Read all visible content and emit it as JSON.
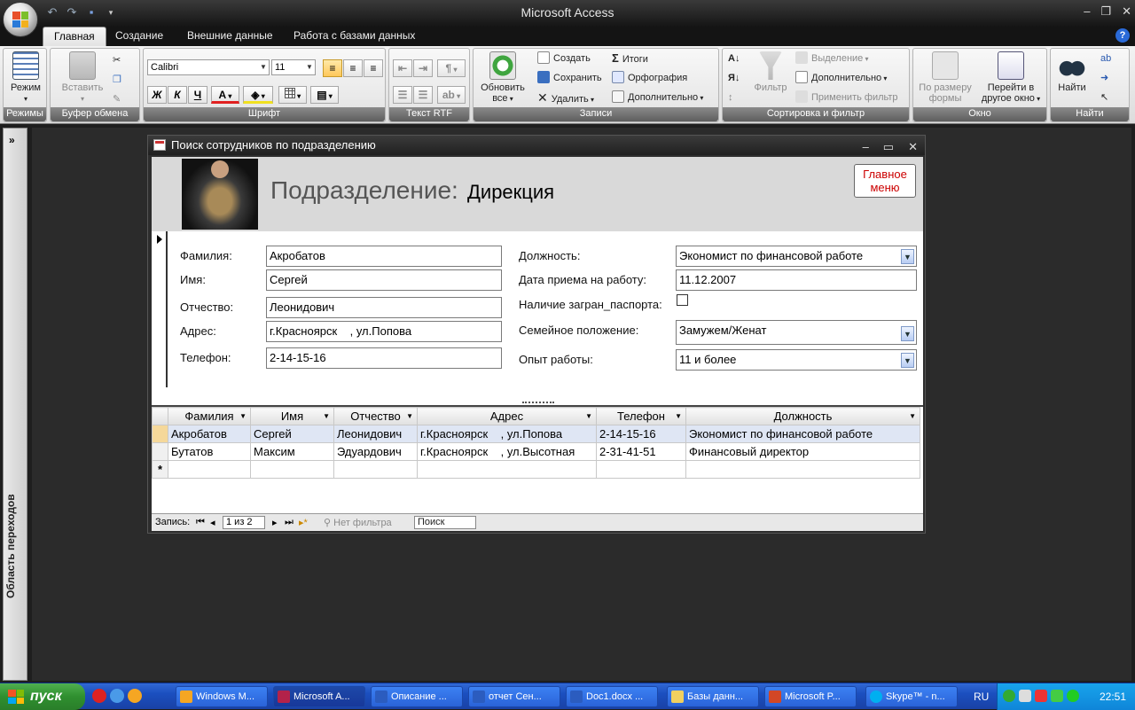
{
  "window": {
    "title": "Microsoft Access"
  },
  "tabs": [
    "Главная",
    "Создание",
    "Внешние данные",
    "Работа с базами данных"
  ],
  "ribbon": {
    "groups": {
      "views": "Режимы",
      "clipboard": "Буфер обмена",
      "font": "Шрифт",
      "rtf": "Текст RTF",
      "records": "Записи",
      "sort": "Сортировка и фильтр",
      "window": "Окно",
      "find": "Найти"
    },
    "view_label": "Режим",
    "paste_label": "Вставить",
    "font_name": "Calibri",
    "font_size": "11",
    "bold": "Ж",
    "italic": "К",
    "underline": "Ч",
    "font_color": "А",
    "refresh_line1": "Обновить",
    "refresh_line2": "все",
    "new": "Создать",
    "save": "Сохранить",
    "delete": "Удалить",
    "totals": "Итоги",
    "spelling": "Орфография",
    "more": "Дополнительно",
    "filter": "Фильтр",
    "selection": "Выделение",
    "advanced": "Дополнительно",
    "apply_filter": "Применить фильтр",
    "fit_form_line1": "По размеру",
    "fit_form_line2": "формы",
    "switch_window_line1": "Перейти в",
    "switch_window_line2": "другое окно",
    "find_label": "Найти"
  },
  "navpane": {
    "label": "Область переходов"
  },
  "form": {
    "title": "Поиск сотрудников по подразделению",
    "header_label": "Подразделение:",
    "header_value": "Дирекция",
    "main_menu_line1": "Главное",
    "main_menu_line2": "меню",
    "fields": {
      "surname_label": "Фамилия:",
      "surname": "Акробатов",
      "name_label": "Имя:",
      "name": "Сергей",
      "patronymic_label": "Отчество:",
      "patronymic": "Леонидович",
      "address_label": "Адрес:",
      "address": "г.Красноярск    , ул.Попова",
      "phone_label": "Телефон:",
      "phone": "2-14-15-16",
      "position_label": "Должность:",
      "position": "Экономист по финансовой работе",
      "hire_label": "Дата приема на работу:",
      "hire_date": "11.12.2007",
      "passport_label": "Наличие загран_паспорта:",
      "marital_label": "Семейное положение:",
      "marital": "Замужем/Женат",
      "experience_label": "Опыт работы:",
      "experience": "11 и более"
    },
    "table": {
      "columns": [
        "Фамилия",
        "Имя",
        "Отчество",
        "Адрес",
        "Телефон",
        "Должность"
      ],
      "rows": [
        [
          "Акробатов",
          "Сергей",
          "Леонидович",
          "г.Красноярск    , ул.Попова",
          "2-14-15-16",
          "Экономист по финансовой работе"
        ],
        [
          "Бутатов",
          "Максим",
          "Эдуардович",
          "г.Красноярск    , ул.Высотная",
          "2-31-41-51",
          "Финансовый директор"
        ]
      ],
      "new_row_marker": "*"
    },
    "navbar": {
      "record_label": "Запись:",
      "record_value": "1 из 2",
      "no_filter": "Нет фильтра",
      "search": "Поиск"
    }
  },
  "taskbar": {
    "start": "пуск",
    "items": [
      "Windows M...",
      "Microsoft A...",
      "Описание ...",
      "отчет Сен...",
      "Doc1.docx ...",
      "Базы данн...",
      "Microsoft P...",
      "Skype™ - n..."
    ],
    "lang": "RU",
    "clock": "22:51"
  }
}
